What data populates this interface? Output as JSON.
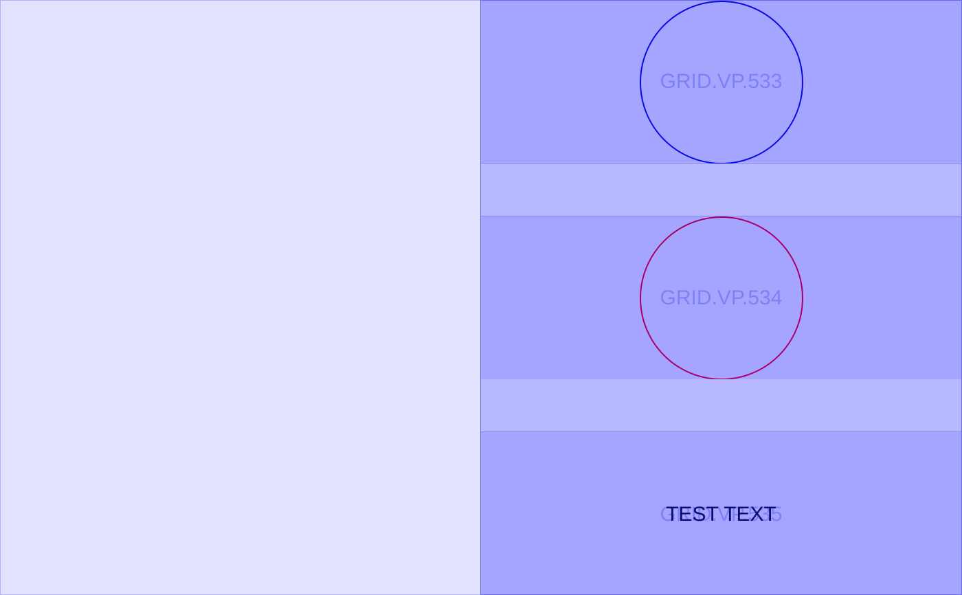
{
  "cells": [
    {
      "label": "GRID.VP.533",
      "marker": "circle",
      "marker_color": "#0a0ae6"
    },
    {
      "label": "GRID.VP.534",
      "marker": "circle",
      "marker_color": "#a8006a"
    },
    {
      "label": "GRID.VP.535",
      "overlay_text": "TEST TEXT"
    }
  ],
  "colors": {
    "left_pane_bg": "#e3e3ff",
    "right_pane_bg": "#b8b8ff",
    "cell_bg": "#a5a5ff",
    "label_color": "#8080f5",
    "overlay_text_color": "#0b0b6e"
  }
}
